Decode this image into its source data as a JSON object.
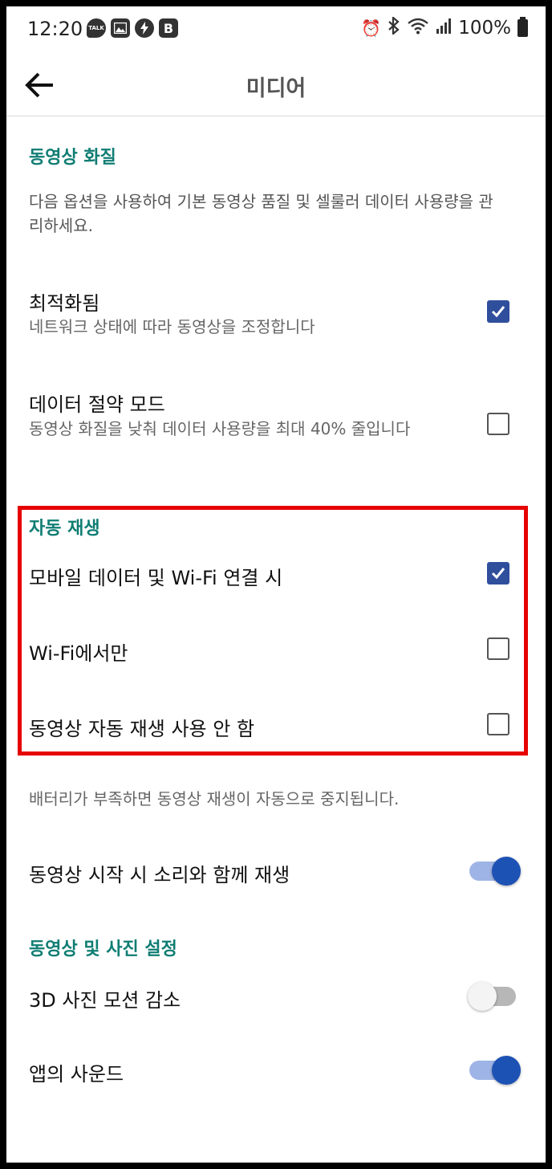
{
  "status_bar": {
    "time": "12:20",
    "left_icons": [
      "kakaotalk-icon",
      "gallery-icon",
      "bolt-icon",
      "b-app-icon"
    ],
    "kakao_text": "TALK",
    "b_text": "B",
    "battery": "100%"
  },
  "app_bar": {
    "title": "미디어"
  },
  "video_quality": {
    "section_title": "동영상 화질",
    "description": "다음 옵션을 사용하여 기본 동영상 품질 및 셀룰러 데이터 사용량을 관리하세요.",
    "options": [
      {
        "title": "최적화됨",
        "subtitle": "네트워크 상태에 따라 동영상을 조정합니다",
        "checked": true
      },
      {
        "title": "데이터 절약 모드",
        "subtitle": "동영상 화질을 낮춰 데이터 사용량을 최대 40% 줄입니다",
        "checked": false
      }
    ]
  },
  "autoplay": {
    "section_title": "자동 재생",
    "options": [
      {
        "title": "모바일 데이터 및 Wi-Fi 연결 시",
        "checked": true
      },
      {
        "title": "Wi-Fi에서만",
        "checked": false
      },
      {
        "title": "동영상 자동 재생 사용 안 함",
        "checked": false
      }
    ],
    "note": "배터리가 부족하면 동영상 재생이 자동으로 중지됩니다.",
    "sound_toggle": {
      "label": "동영상 시작 시 소리와 함께 재생",
      "on": true
    }
  },
  "video_photo_settings": {
    "section_title": "동영상 및 사진 설정",
    "toggles": [
      {
        "label": "3D 사진 모션 감소",
        "on": false
      },
      {
        "label": "앱의 사운드",
        "on": true
      }
    ]
  },
  "colors": {
    "accent_teal": "#0f7d73",
    "checkbox_blue": "#2f4e9c",
    "toggle_blue": "#1d52b5",
    "highlight_red": "#e60000"
  }
}
